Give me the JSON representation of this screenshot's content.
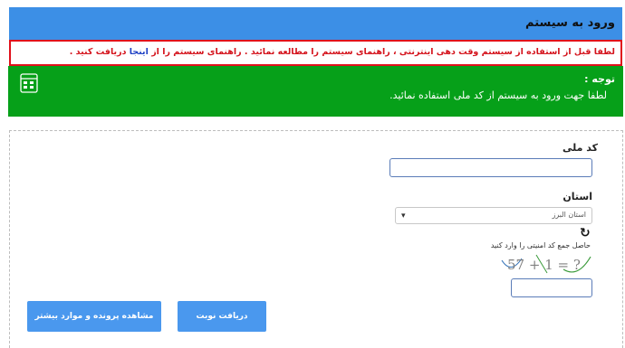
{
  "header": {
    "title": "ورود به سیستم"
  },
  "alert": {
    "prefix": "لطفا قبل از استفاده از سیستم وقت دهی اینترنتی ، راهنمای سیستم را مطالعه نمائید . راهنمای سیستم را از",
    "link": "اینجا",
    "suffix": "دریافت کنید ."
  },
  "notice": {
    "title": "توجه :",
    "body": "لطفا جهت ورود به سیستم از کد ملی استفاده نمائید.",
    "icon": "calculator-icon"
  },
  "form": {
    "national_code_label": "کد ملی",
    "national_code_value": "",
    "province_label": "استان",
    "province_selected": "استان البرز",
    "captcha_hint": "حاصل جمع کد امنیتی را وارد کنید",
    "captcha_text": "57 + 1 = ?",
    "captcha_value": "",
    "submit_label": "دریافت نوبت",
    "more_label": "مشاهده پرونده و موارد بیشتر"
  },
  "colors": {
    "header": "#3c8fe6",
    "alert_border": "#e0101b",
    "notice": "#06a019",
    "button": "#4a98ee"
  }
}
